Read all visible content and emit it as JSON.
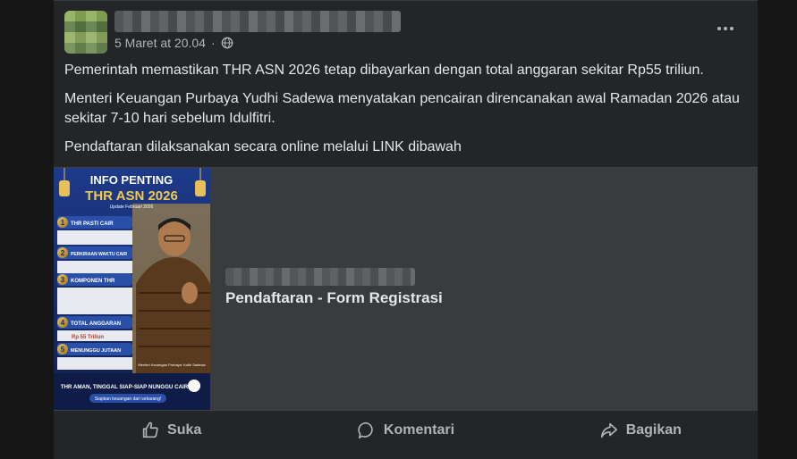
{
  "post": {
    "timestamp": "5 Maret at 20.04",
    "privacy_icon": "globe-icon",
    "more_icon": "more-options-icon",
    "paragraphs": [
      "Pemerintah memastikan THR ASN 2026 tetap dibayarkan dengan total anggaran sekitar Rp55 triliun.",
      "Menteri Keuangan Purbaya Yudhi Sadewa menyatakan pencairan direncanakan awal Ramadan 2026 atau sekitar 7-10 hari sebelum Idulfitri.",
      "Pendaftaran dilaksanakan secara online melalui LINK dibawah"
    ]
  },
  "link_preview": {
    "title": "Pendaftaran - Form Registrasi",
    "image": {
      "heading1": "INFO PENTING",
      "heading2": "THR ASN 2026",
      "update_note": "Update Februari 2026",
      "sections": [
        {
          "num": "1",
          "title": "THR PASTI CAIR"
        },
        {
          "num": "2",
          "title": "PERKIRAAN WAKTU CAIR"
        },
        {
          "num": "3",
          "title": "KOMPONEN THR"
        },
        {
          "num": "4",
          "title": "TOTAL ANGGARAN"
        },
        {
          "num": "5",
          "title": "MENUNGGU JUTAAN"
        }
      ],
      "budget": "Rp 55 Triliun",
      "caption": "Menteri Keuangan Purbaya Yudhi Sadewa",
      "footer": "THR AMAN, TINGGAL SIAP-SIAP NUNGGU CAIR!",
      "footer_sub": "Siapkan keuangan dari sekarang!"
    }
  },
  "actions": [
    {
      "label": "Suka",
      "icon": "like-icon"
    },
    {
      "label": "Komentari",
      "icon": "comment-icon"
    },
    {
      "label": "Bagikan",
      "icon": "share-icon"
    }
  ]
}
